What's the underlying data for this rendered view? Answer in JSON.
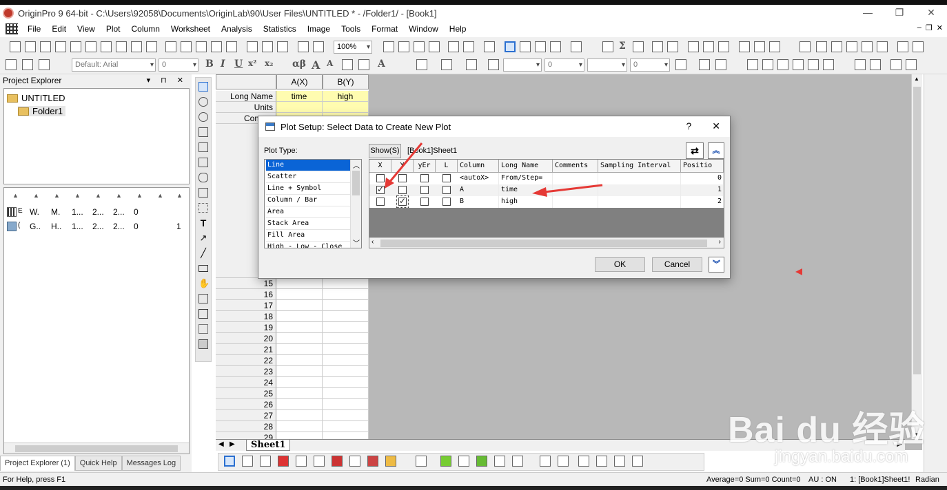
{
  "window": {
    "title": "OriginPro 9 64-bit - C:\\Users\\92058\\Documents\\OriginLab\\90\\User Files\\UNTITLED * - /Folder1/ - [Book1]",
    "minimize": "—",
    "restore": "❐",
    "close": "✕"
  },
  "menu": {
    "items": [
      "File",
      "Edit",
      "View",
      "Plot",
      "Column",
      "Worksheet",
      "Analysis",
      "Statistics",
      "Image",
      "Tools",
      "Format",
      "Window",
      "Help"
    ],
    "mdi_min": "–",
    "mdi_restore": "❐",
    "mdi_close": "✕"
  },
  "toolbar": {
    "zoom": "100%",
    "font": "Default: Arial",
    "font_size": "0",
    "line_width": "0",
    "fill_size": "0",
    "glyphs": {
      "bold": "B",
      "italic": "I",
      "underline": "U",
      "sup": "x²",
      "sub": "x₂",
      "greek": "αβ",
      "bigA": "A",
      "smallA": "A",
      "sigma": "Σ"
    }
  },
  "project_explorer": {
    "title": "Project Explorer",
    "title_buttons": "▾ ⊓ ✕",
    "root": "UNTITLED",
    "folder": "Folder1",
    "rows": [
      {
        "c1": "W.",
        "c2": "M.",
        "c3": "1...",
        "c4": "2...",
        "c5": "2...",
        "c6": "0",
        "c7": ""
      },
      {
        "c1": "G..",
        "c2": "H..",
        "c3": "1...",
        "c4": "2...",
        "c5": "2...",
        "c6": "0",
        "c7": "1"
      }
    ],
    "row_prefixes": [
      "E",
      "("
    ]
  },
  "bottom_tabs": [
    "Project Explorer (1)",
    "Quick Help",
    "Messages Log"
  ],
  "worksheet": {
    "columns": [
      "A(X)",
      "B(Y)"
    ],
    "label_rows": [
      {
        "label": "Long Name",
        "a": "time",
        "b": "high"
      },
      {
        "label": "Units",
        "a": "",
        "b": ""
      },
      {
        "label": "Comme",
        "a": "",
        "b": ""
      }
    ],
    "row_numbers": [
      "15",
      "16",
      "17",
      "18",
      "19",
      "20",
      "21",
      "22",
      "23",
      "24",
      "25",
      "26",
      "27",
      "28",
      "29"
    ],
    "sheet_tab": "Sheet1"
  },
  "dialog": {
    "title": "Plot Setup: Select Data to Create New Plot",
    "help": "?",
    "close": "✕",
    "plot_type_label": "Plot Type:",
    "plot_types": [
      "Line",
      "Scatter",
      "Line + Symbol",
      "Column / Bar",
      "Area",
      "Stack Area",
      "Fill Area",
      "High - Low - Close"
    ],
    "show_label": "Show(S)",
    "book_ref": "[Book1]Sheet1",
    "grid_headers": [
      "X",
      "Y",
      "yEr",
      "L",
      "Column",
      "Long Name",
      "Comments",
      "Sampling Interval",
      "Positio"
    ],
    "grid_rows": [
      {
        "x": false,
        "y": false,
        "yerr": false,
        "l": false,
        "column": "<autoX>",
        "long_name": "From/Step=",
        "comments": "",
        "sampling": "",
        "position": "0"
      },
      {
        "x": true,
        "y": false,
        "yerr": false,
        "l": false,
        "column": "A",
        "long_name": "time",
        "comments": "",
        "sampling": "",
        "position": "1"
      },
      {
        "x": false,
        "y": true,
        "yerr": false,
        "l": false,
        "column": "B",
        "long_name": "high",
        "comments": "",
        "sampling": "",
        "position": "2"
      }
    ],
    "ok": "OK",
    "cancel": "Cancel"
  },
  "status": {
    "help": "For Help, press F1",
    "stats": "Average=0 Sum=0 Count=0",
    "au": "AU : ON",
    "sheet": "1: [Book1]Sheet1!",
    "angle": "Radian"
  },
  "watermark": {
    "big": "Bai du 经验",
    "small": "jingyan.baidu.com"
  },
  "colors": {
    "selection": "#0a64d6",
    "annotation_arrow": "#e53935",
    "label_row": "#fffcb0"
  }
}
